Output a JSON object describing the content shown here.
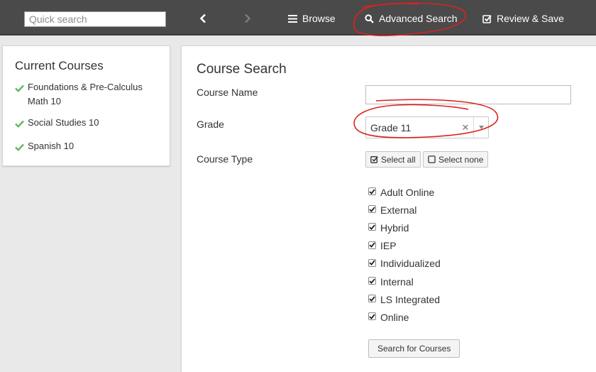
{
  "topbar": {
    "search_placeholder": "Quick search",
    "back_icon": "chevron-left-icon",
    "forward_icon": "chevron-right-icon",
    "browse_label": "Browse",
    "browse_icon": "list-icon",
    "advanced_search_label": "Advanced Search",
    "advanced_search_icon": "search-icon",
    "review_save_label": "Review & Save",
    "review_save_icon": "checkbox-icon"
  },
  "sidebar": {
    "title": "Current Courses",
    "items": [
      {
        "label": "Foundations & Pre-Calculus Math 10"
      },
      {
        "label": "Social Studies 10"
      },
      {
        "label": "Spanish 10"
      }
    ]
  },
  "main": {
    "title": "Course Search",
    "course_name_label": "Course Name",
    "course_name_value": "",
    "grade_label": "Grade",
    "grade_value": "Grade 11",
    "course_type_label": "Course Type",
    "select_all_label": "Select all",
    "select_none_label": "Select none",
    "course_types": [
      {
        "label": "Adult Online",
        "checked": true
      },
      {
        "label": "External",
        "checked": true
      },
      {
        "label": "Hybrid",
        "checked": true
      },
      {
        "label": "IEP",
        "checked": true
      },
      {
        "label": "Individualized",
        "checked": true
      },
      {
        "label": "Internal",
        "checked": true
      },
      {
        "label": "LS Integrated",
        "checked": true
      },
      {
        "label": "Online",
        "checked": true
      }
    ],
    "search_button_label": "Search for Courses"
  },
  "colors": {
    "topbar_bg": "#4a4a4a",
    "check_green": "#5cb85c",
    "annotation_red": "#d9231e"
  }
}
